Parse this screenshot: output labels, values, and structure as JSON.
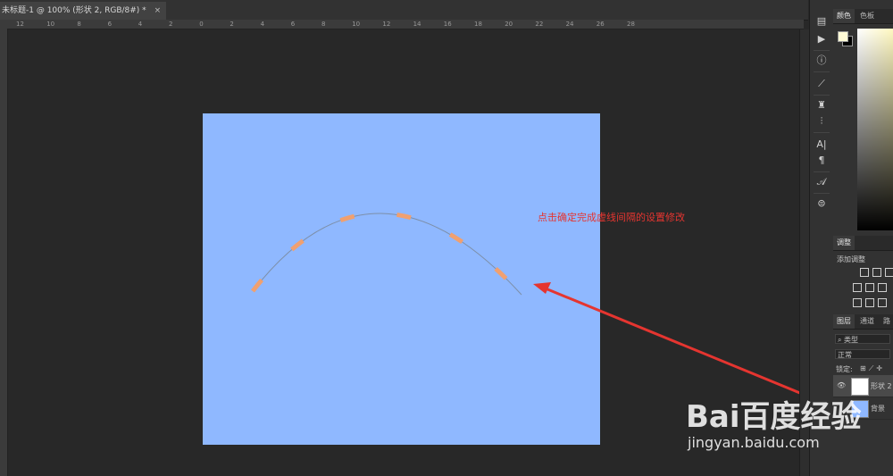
{
  "document_tab": {
    "title": "未标题-1 @ 100% (形状 2, RGB/8#) *",
    "close_glyph": "×"
  },
  "ruler": {
    "ticks": [
      "12",
      "10",
      "8",
      "6",
      "4",
      "2",
      "0",
      "2",
      "4",
      "6",
      "8",
      "10",
      "12",
      "14",
      "16",
      "18",
      "20",
      "22",
      "24",
      "26",
      "28"
    ]
  },
  "canvas": {
    "background": "#8fb8ff"
  },
  "annotation": {
    "text": "点击确定完成虚线间隔的设置修改",
    "color": "#e53530"
  },
  "right_toolbar": {
    "icons": [
      "color-panel-icon",
      "play-icon",
      "info-icon",
      "brush-preset-icon",
      "clone-source-icon",
      "adjust-sliders-icon",
      "character-icon",
      "paragraph-icon",
      "glyphs-icon",
      "layer-comps-icon"
    ],
    "glyphs": [
      "▤",
      "▶",
      "ⓘ",
      "⟋",
      "♜",
      "⫶",
      "A|",
      "¶",
      "𝒜",
      "⊜"
    ]
  },
  "color_panel": {
    "tabs": [
      "颜色",
      "色板"
    ],
    "foreground": "#fffbd6",
    "background": "#000000"
  },
  "adjustments_panel": {
    "tab": "调整",
    "add_label": "添加调整"
  },
  "layers_panel": {
    "tabs": [
      "图层",
      "通道",
      "路"
    ],
    "filter": "类型",
    "blend_mode": "正常",
    "lock_label": "锁定:",
    "layers": [
      {
        "name": "形状 2",
        "visible": true,
        "thumb_color": "#ffffff"
      },
      {
        "name": "背景",
        "visible": true,
        "thumb_color": "#8fb8ff"
      }
    ]
  },
  "watermark": {
    "brand": "Bai百度经验",
    "url": "jingyan.baidu.com"
  }
}
